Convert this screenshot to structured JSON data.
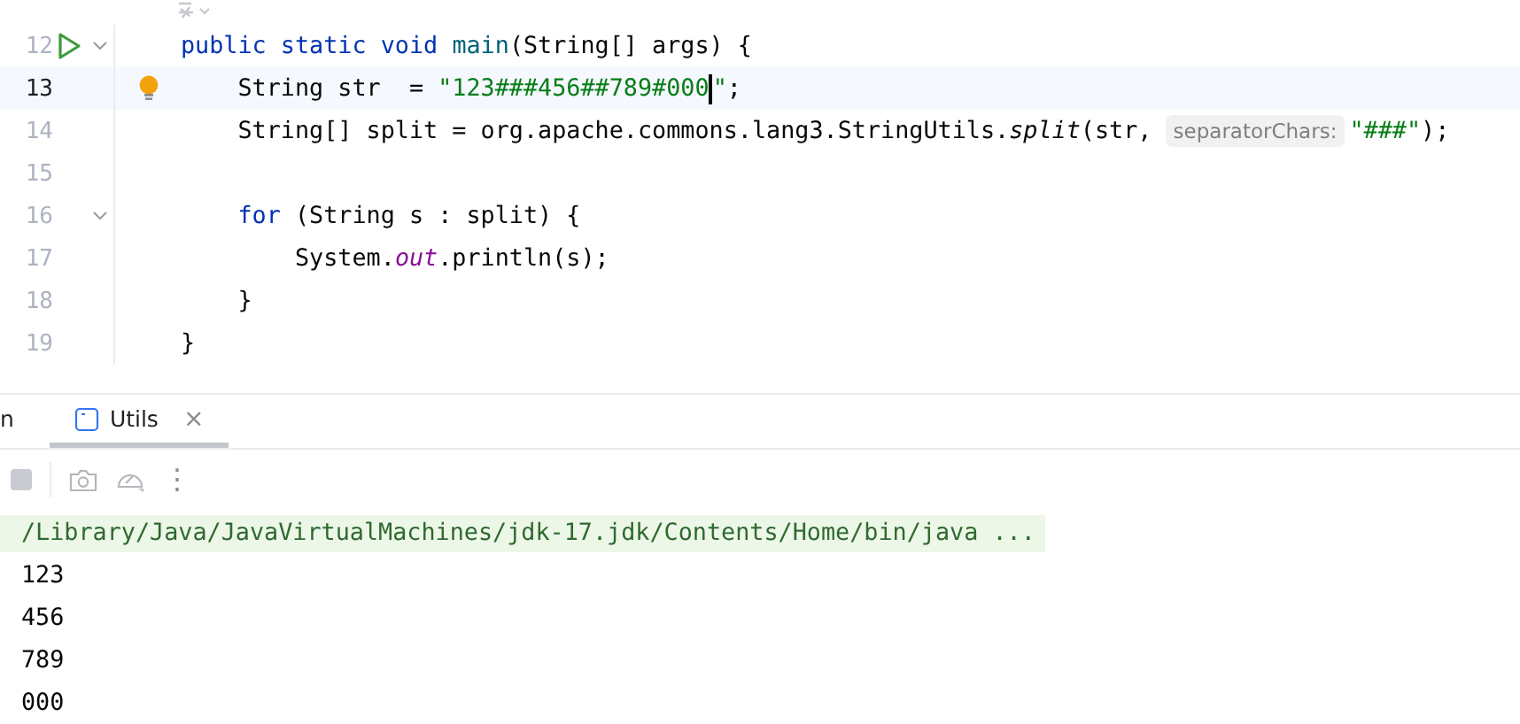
{
  "editor": {
    "lines": [
      {
        "number": "12",
        "run": true,
        "fold": true,
        "bulb": false,
        "current": false,
        "tokens": [
          {
            "kind": "keyword",
            "text": "public static void "
          },
          {
            "kind": "method",
            "text": "main"
          },
          {
            "kind": "plain",
            "text": "(String[] args) {"
          }
        ]
      },
      {
        "number": "13",
        "run": false,
        "fold": false,
        "bulb": true,
        "current": true,
        "tokens": [
          {
            "kind": "plain",
            "text": "    String str  = "
          },
          {
            "kind": "string",
            "text": "\"123###456##789#000"
          },
          {
            "kind": "caret"
          },
          {
            "kind": "string",
            "text": "\""
          },
          {
            "kind": "plain",
            "text": ";"
          }
        ]
      },
      {
        "number": "14",
        "run": false,
        "fold": false,
        "bulb": false,
        "current": false,
        "tokens": [
          {
            "kind": "plain",
            "text": "    String[] split = org.apache.commons.lang3.StringUtils."
          },
          {
            "kind": "static_method",
            "text": "split"
          },
          {
            "kind": "plain",
            "text": "(str, "
          },
          {
            "kind": "hint",
            "text": "separatorChars:"
          },
          {
            "kind": "string",
            "text": "\"###\""
          },
          {
            "kind": "plain",
            "text": ");"
          }
        ]
      },
      {
        "number": "15",
        "run": false,
        "fold": false,
        "bulb": false,
        "current": false
      },
      {
        "number": "16",
        "run": false,
        "fold": true,
        "bulb": false,
        "current": false,
        "tokens": [
          {
            "kind": "keyword",
            "text": "    for"
          },
          {
            "kind": "plain",
            "text": " (String s : split) {"
          }
        ]
      },
      {
        "number": "17",
        "run": false,
        "fold": false,
        "bulb": false,
        "current": false,
        "tokens": [
          {
            "kind": "plain",
            "text": "        System."
          },
          {
            "kind": "field",
            "text": "out"
          },
          {
            "kind": "plain",
            "text": ".println(s);"
          }
        ]
      },
      {
        "number": "18",
        "run": false,
        "fold": false,
        "bulb": false,
        "current": false,
        "tokens": [
          {
            "kind": "plain",
            "text": "    }"
          }
        ]
      },
      {
        "number": "19",
        "run": false,
        "fold": false,
        "bulb": false,
        "current": false,
        "tokens": [
          {
            "kind": "plain",
            "text": "}"
          }
        ]
      }
    ]
  },
  "run_panel": {
    "tabs": [
      {
        "label": "n",
        "selected": false,
        "icon": false,
        "closable": false
      },
      {
        "label": "Utils",
        "selected": true,
        "icon": true,
        "closable": true
      }
    ],
    "close_glyph": "×",
    "toolbar": {
      "stop_disabled": true,
      "more_glyph": "⋮"
    },
    "console": [
      {
        "text": "/Library/Java/JavaVirtualMachines/jdk-17.jdk/Contents/Home/bin/java ...",
        "kind": "command"
      },
      {
        "text": "123",
        "kind": "output"
      },
      {
        "text": "456",
        "kind": "output"
      },
      {
        "text": "789",
        "kind": "output"
      },
      {
        "text": "000",
        "kind": "output"
      }
    ]
  }
}
